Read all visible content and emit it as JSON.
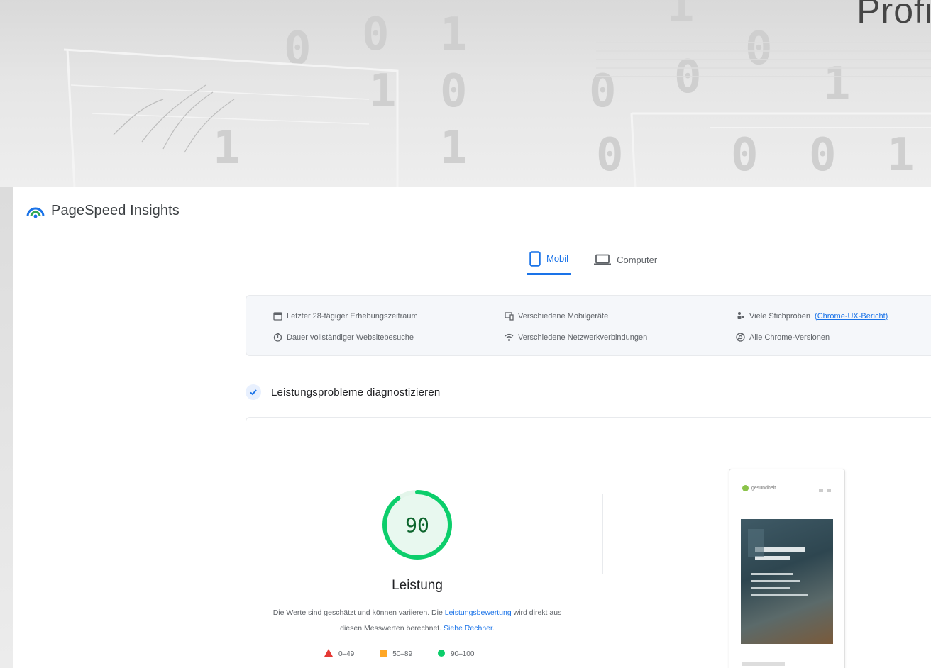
{
  "banner": {
    "title": "Profiti"
  },
  "app": {
    "title": "PageSpeed Insights"
  },
  "tabs": [
    {
      "label": "Mobil",
      "icon": "smartphone-icon",
      "active": true
    },
    {
      "label": "Computer",
      "icon": "laptop-icon",
      "active": false
    }
  ],
  "field_info": {
    "col1": [
      {
        "icon": "calendar-icon",
        "text": "Letzter 28-tägiger Erhebungszeitraum"
      },
      {
        "icon": "timer-icon",
        "text": "Dauer vollständiger Websitebesuche"
      }
    ],
    "col2": [
      {
        "icon": "devices-icon",
        "text": "Verschiedene Mobilgeräte"
      },
      {
        "icon": "wifi-icon",
        "text": "Verschiedene Netzwerkverbindungen"
      }
    ],
    "col3": [
      {
        "icon": "people-icon",
        "text": "Viele Stichproben",
        "link": "(Chrome-UX-Bericht)"
      },
      {
        "icon": "chrome-icon",
        "text": "Alle Chrome-Versionen"
      }
    ]
  },
  "diagnose": {
    "title": "Leistungsprobleme diagnostizieren"
  },
  "performance": {
    "score": "90",
    "score_fraction": 0.9,
    "label": "Leistung",
    "desc_part1": "Die Werte sind geschätzt und können variieren. Die ",
    "desc_link1": "Leistungsbewertung",
    "desc_part2": " wird direkt aus diesen Messwerten berechnet. ",
    "desc_link2": "Siehe Rechner",
    "desc_part3": ".",
    "legend": [
      {
        "range": "0–49",
        "shape": "triangle",
        "color": "#e53935"
      },
      {
        "range": "50–89",
        "shape": "square",
        "color": "#ffa726"
      },
      {
        "range": "90–100",
        "shape": "circle",
        "color": "#0cce6b"
      }
    ]
  },
  "thumbnail": {
    "brand": "gesundheit"
  },
  "colors": {
    "accent": "#1a73e8",
    "good": "#0cce6b",
    "good_text": "#0d652d"
  }
}
